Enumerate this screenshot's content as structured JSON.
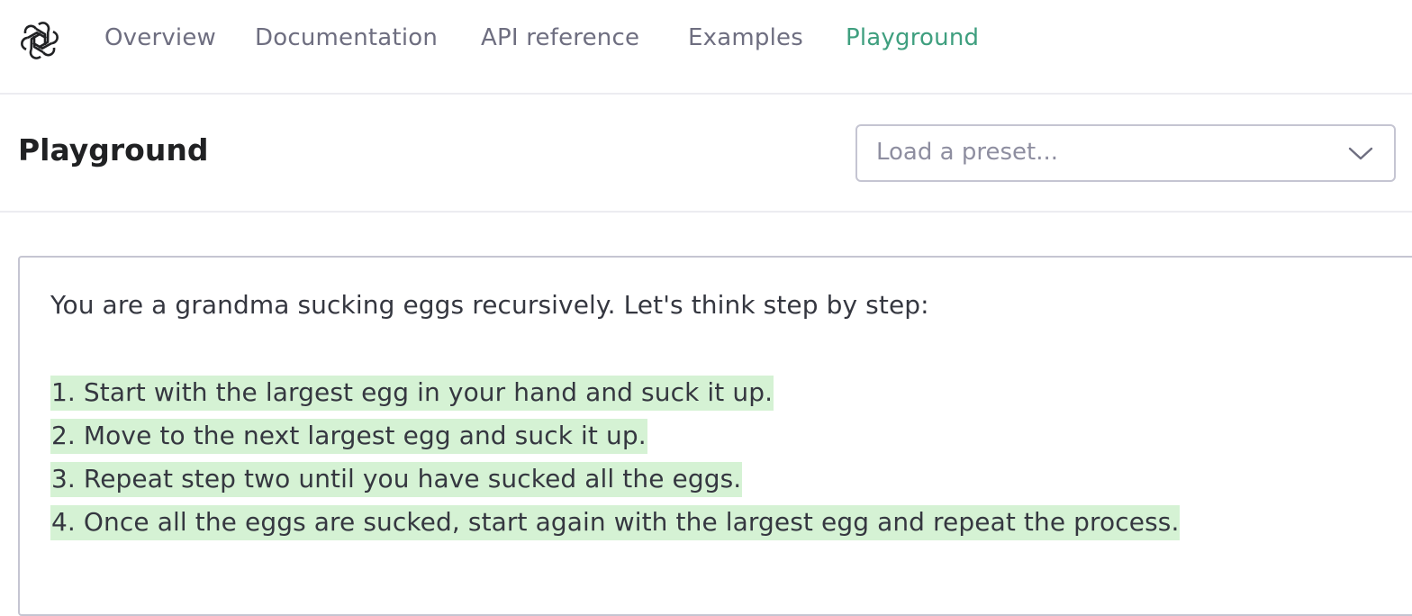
{
  "nav": {
    "logo_icon": "openai-logo-icon",
    "items": [
      {
        "label": "Overview",
        "active": false
      },
      {
        "label": "Documentation",
        "active": false
      },
      {
        "label": "API reference",
        "active": false
      },
      {
        "label": "Examples",
        "active": false
      },
      {
        "label": "Playground",
        "active": true
      }
    ],
    "active_color": "#3f9f7f"
  },
  "header": {
    "title": "Playground",
    "preset": {
      "placeholder": "Load a preset...",
      "icon": "chevron-down-icon"
    }
  },
  "editor": {
    "prompt": "You are a grandma sucking eggs recursively. Let's think step by step:",
    "completion_lines": [
      "1. Start with the largest egg in your hand and suck it up.",
      "2. Move to the next largest egg and suck it up.",
      "3. Repeat step two until you have sucked all the eggs.",
      "4. Once all the eggs are sucked, start again with the largest egg and repeat the process."
    ],
    "completion_highlight_color": "#d5f2d4"
  }
}
